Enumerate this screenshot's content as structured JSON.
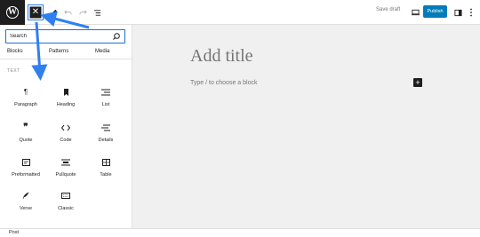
{
  "toolbar": {
    "close_symbol": "✕",
    "save_draft_label": "Save draft",
    "publish_label": "Publish",
    "icons": [
      "wordpress-logo",
      "close-icon",
      "pencil-icon",
      "undo-icon",
      "redo-icon",
      "list-view-icon",
      "desktop-preview-icon",
      "sidebar-toggle-icon",
      "more-options-icon"
    ]
  },
  "inserter": {
    "search": {
      "value": "",
      "placeholder": "Search"
    },
    "tabs": [
      {
        "label": "Blocks"
      },
      {
        "label": "Patterns"
      },
      {
        "label": "Media"
      }
    ],
    "section_label": "TEXT",
    "blocks": [
      {
        "label": "Paragraph",
        "icon": "paragraph-icon"
      },
      {
        "label": "Heading",
        "icon": "heading-icon"
      },
      {
        "label": "List",
        "icon": "list-icon"
      },
      {
        "label": "Quote",
        "icon": "quote-icon"
      },
      {
        "label": "Code",
        "icon": "code-icon"
      },
      {
        "label": "Details",
        "icon": "details-icon"
      },
      {
        "label": "Preformatted",
        "icon": "preformatted-icon"
      },
      {
        "label": "Pullquote",
        "icon": "pullquote-icon"
      },
      {
        "label": "Table",
        "icon": "table-icon"
      },
      {
        "label": "Verse",
        "icon": "verse-icon"
      },
      {
        "label": "Classic",
        "icon": "classic-icon"
      }
    ]
  },
  "editor": {
    "title_placeholder": "Add title",
    "block_hint": "Type / to choose a block",
    "add_block_symbol": "+"
  },
  "footer": {
    "label": "Post"
  },
  "colors": {
    "accent_blue": "#007cba",
    "annotation_blue": "#2f7ff0",
    "canvas_bg": "#f0f0f0",
    "dark": "#1e1e1e"
  }
}
